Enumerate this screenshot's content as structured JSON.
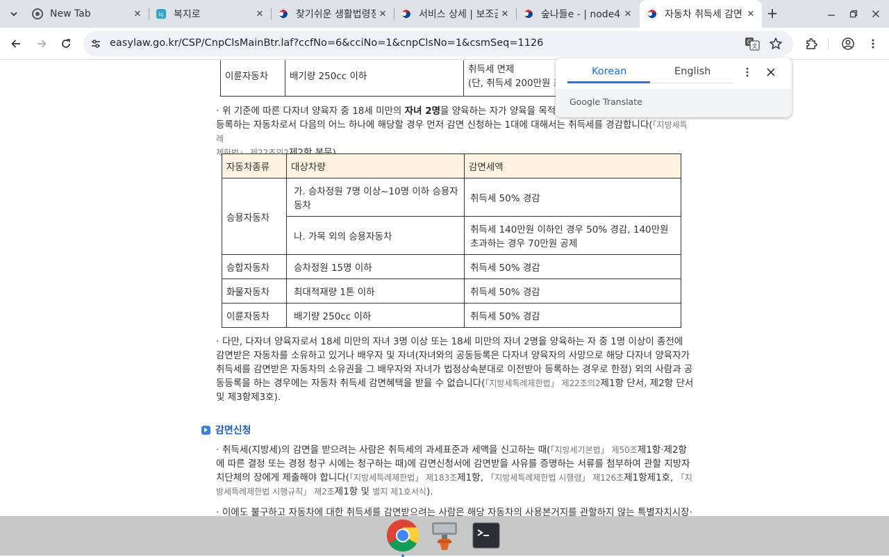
{
  "tabs": [
    {
      "title": "New Tab",
      "icon": "chrome-icon"
    },
    {
      "title": "복지로",
      "icon": "bokjiro-icon"
    },
    {
      "title": "찾기쉬운 생활법령정",
      "icon": "korea-flag-icon"
    },
    {
      "title": "서비스 상세 | 보조금",
      "icon": "korea-flag-icon"
    },
    {
      "title": "숲나들e - | node4",
      "icon": "korea-flag-icon"
    },
    {
      "title": "자동차 취득세 감면",
      "icon": "korea-flag-icon",
      "active": true
    }
  ],
  "toolbar": {
    "url": "easylaw.go.kr/CSP/CnpClsMainBtr.laf?ccfNo=6&cciNo=1&cnpClsNo=1&csmSeq=1126"
  },
  "translate_popup": {
    "lang_from": "Korean",
    "lang_to": "English",
    "brand": "Google Translate"
  },
  "top_table": {
    "row": [
      "이륜자동차",
      "배기량 250cc 이하",
      "취득세 면제",
      "(단, 취득세 200만원 초"
    ]
  },
  "para1": {
    "prefix": "위 기준에 따른 다자녀 양육자 중 18세 미만의 ",
    "bold": "자녀 2명",
    "middle": "을 양육하는 자가 양육을 목적으로",
    "line2": "등록하는 자동차로서 다음의 어느 하나에 해당할 경우 먼저 감면 신청하는 1대에 대해서는 취득세를 경감합니다(",
    "ref1": "「지방세특례",
    "ref1b": "제한법」 제22조의2",
    "tail": "제2항 본문)."
  },
  "main_table": {
    "headers": [
      "자동차종류",
      "대상차량",
      "감면세액"
    ],
    "rows": {
      "r1a": [
        "승용자동차",
        "가. 승차정원 7명 이상~10명 이하 승용자동차",
        "취득세 50% 경감"
      ],
      "r1b": [
        "나. 가목 외의 승용자동차",
        "취득세 140만원 이하인 경우 50% 경감, 140만원 초과하는 경우 70만원 공제"
      ],
      "r2": [
        "승합자동차",
        "승차정원 15명 이하",
        "취득세 50% 경감"
      ],
      "r3": [
        "화물자동차",
        "최대적재량 1톤 이하",
        "취득세 50% 경감"
      ],
      "r4": [
        "이륜자동차",
        "배기량 250cc 이하",
        "취득세 50% 경감"
      ]
    }
  },
  "para2": {
    "text": "다만, 다자녀 양육자로서 18세 미만의 자녀 3명 이상 또는 18세 미만의 자녀 2명을 양육하는 자 중 1명 이상이 종전에 감면받은 자동차를 소유하고 있거나 배우자 및 자녀(자녀와의 공동등록은 다자녀 양육자의 사망으로 해당 다자녀 양육자가 취득세를 감면받은 자동차의 소유권을 그 배우자와 자녀가 법정상속분대로 이전받아 등록하는 경우로 한정) 외의 사람과 공동등록을 하는 경우에는 자동차 취득세 감면혜택을 받을 수 없습니다(",
    "ref": "「지방세특례제한법」 제22조의2",
    "tail": "제1항 단서, 제2항 단서 및 제3항제3호)."
  },
  "section": {
    "title": "감면신청"
  },
  "para3": {
    "a": "취득세(지방세)의 감면을 받으려는 사람은 취득세의 과세표준과 세액을 신고하는 때(",
    "ref1": "「지방세기본법」 제50조",
    "b": "제1항·제2항에 따른 결정 또는 경정 청구 시에는 청구하는 때)에 감면신청서에 감면받을 사유를 증명하는 서류를 첨부하여 관할 지방자치단체의 장에게 제출해야 합니다(",
    "ref2": "「지방세특례제한법」 제183조",
    "c": "제1항, ",
    "ref3": "「지방세특례제한법 시행령」 제126조",
    "d": "제1항제1호, ",
    "ref4": "「지방세특례제한법 시행규칙」 제2조",
    "e": "제1항 및 ",
    "ref5": "별지 제1호서식",
    "f": ")."
  },
  "para4": {
    "text": "이에도 불구하고 자동차에 대한 취득세를 감면받으려는 사람은 해당 자동차의 사용본거지를 관할하지 않는 특별자치시장·"
  },
  "dock": [
    "chrome-icon",
    "remote-desktop-icon",
    "terminal-icon"
  ]
}
